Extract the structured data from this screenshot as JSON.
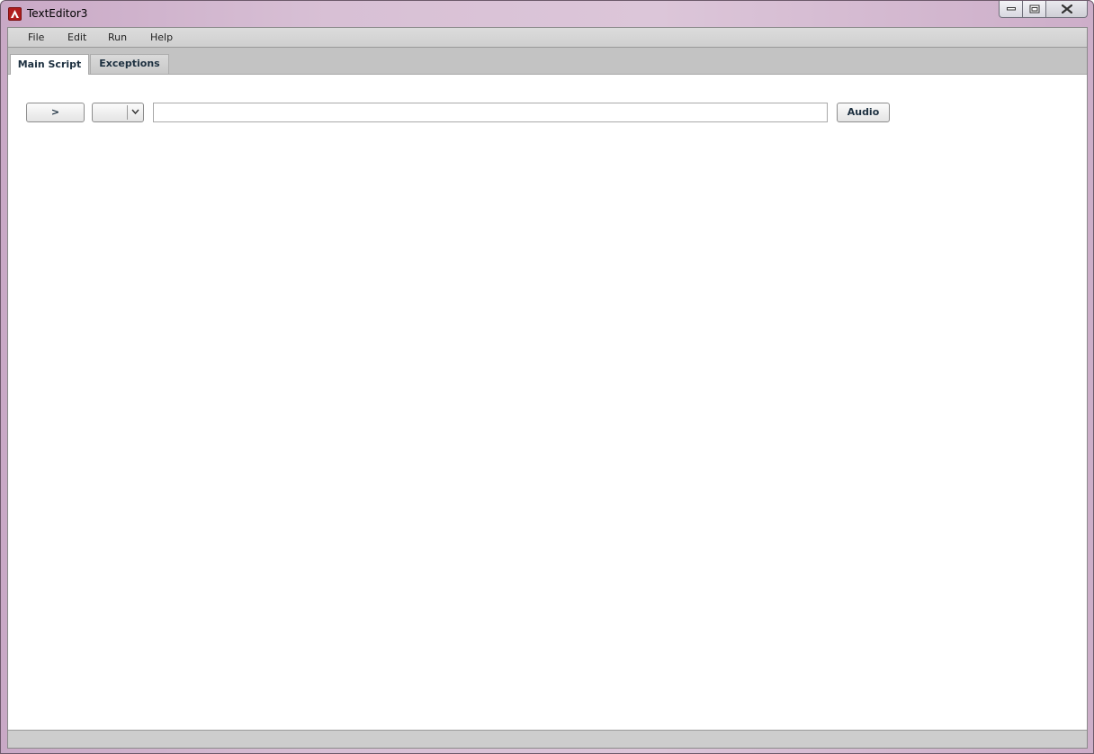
{
  "window": {
    "title": "TextEditor3"
  },
  "menubar": {
    "items": [
      {
        "label": "File"
      },
      {
        "label": "Edit"
      },
      {
        "label": "Run"
      },
      {
        "label": "Help"
      }
    ]
  },
  "tabs": [
    {
      "label": "Main Script",
      "active": true
    },
    {
      "label": "Exceptions",
      "active": false
    }
  ],
  "toolbar": {
    "run_label": ">",
    "combo_value": "",
    "command_value": "",
    "audio_label": "Audio"
  },
  "statusbar": {
    "text": ""
  },
  "colors": {
    "title_gradient": "#d8c0d5",
    "app_icon": "#b01d1d",
    "tab_text": "#1d3040"
  }
}
